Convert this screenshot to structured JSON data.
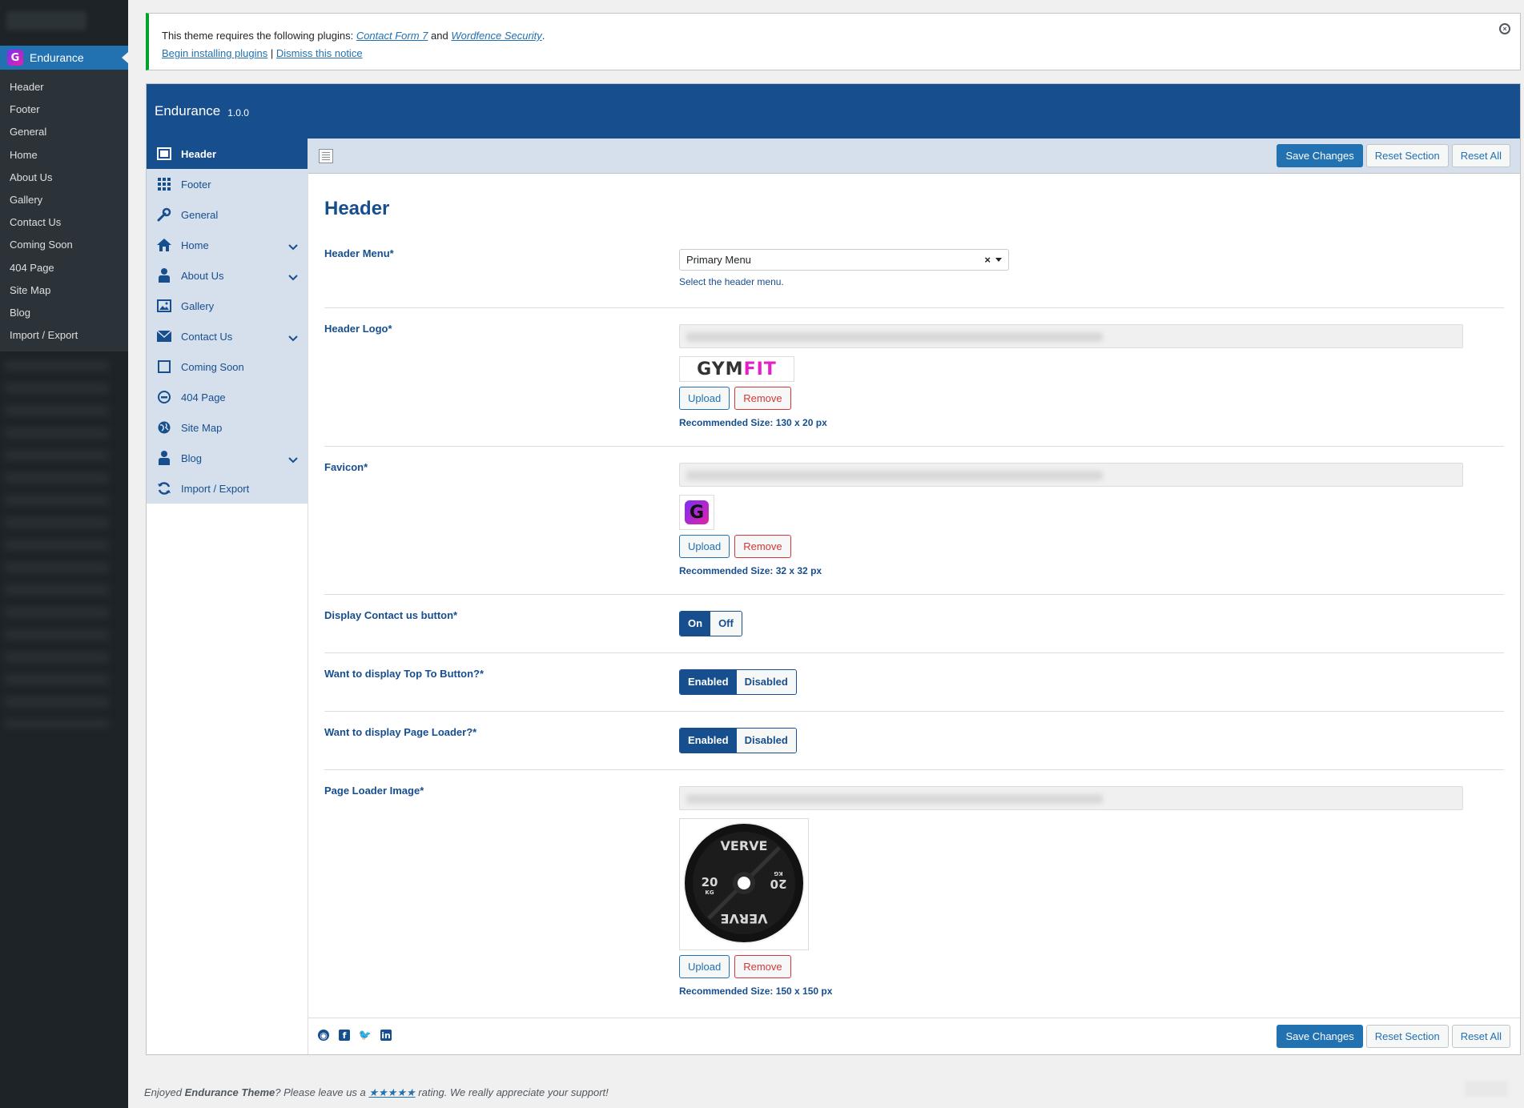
{
  "wp_menu": {
    "active": "Endurance",
    "items": [
      "Header",
      "Footer",
      "General",
      "Home",
      "About Us",
      "Gallery",
      "Contact Us",
      "Coming Soon",
      "404 Page",
      "Site Map",
      "Blog",
      "Import / Export"
    ]
  },
  "notice": {
    "text_prefix": "This theme requires the following plugins:",
    "plugin_1": "Contact Form 7",
    "and": "and",
    "plugin_2": "Wordfence Security",
    "dot": ".",
    "begin_link": "Begin installing plugins",
    "sep": "|",
    "dismiss_link": "Dismiss this notice"
  },
  "panel": {
    "title": "Endurance",
    "version": "1.0.0"
  },
  "nav": [
    {
      "label": "Header",
      "icon": "window-icon",
      "active": true
    },
    {
      "label": "Footer",
      "icon": "grid-icon"
    },
    {
      "label": "General",
      "icon": "wrench-icon"
    },
    {
      "label": "Home",
      "icon": "home-icon",
      "chevron": true
    },
    {
      "label": "About Us",
      "icon": "user-icon",
      "chevron": true
    },
    {
      "label": "Gallery",
      "icon": "image-icon"
    },
    {
      "label": "Contact Us",
      "icon": "envelope-icon",
      "chevron": true
    },
    {
      "label": "Coming Soon",
      "icon": "square-icon"
    },
    {
      "label": "404 Page",
      "icon": "minus-circle-icon"
    },
    {
      "label": "Site Map",
      "icon": "globe-icon"
    },
    {
      "label": "Blog",
      "icon": "user-icon",
      "chevron": true
    },
    {
      "label": "Import / Export",
      "icon": "refresh-icon"
    }
  ],
  "toolbar": {
    "save": "Save Changes",
    "reset_section": "Reset Section",
    "reset_all": "Reset All"
  },
  "section": {
    "title": "Header",
    "header_menu": {
      "label": "Header Menu*",
      "value": "Primary Menu",
      "clear": "×",
      "desc": "Select the header menu."
    },
    "header_logo": {
      "label": "Header Logo*",
      "logo_text_dark": "GYM",
      "logo_text_pink": "FIT",
      "upload": "Upload",
      "remove": "Remove",
      "rec": "Recommended Size: 130 x 20 px"
    },
    "favicon": {
      "label": "Favicon*",
      "glyph": "G",
      "upload": "Upload",
      "remove": "Remove",
      "rec": "Recommended Size: 32 x 32 px"
    },
    "contact_button": {
      "label": "Display Contact us button*",
      "on": "On",
      "off": "Off"
    },
    "top_button": {
      "label": "Want to display Top To Button?*",
      "on": "Enabled",
      "off": "Disabled"
    },
    "page_loader": {
      "label": "Want to display Page Loader?*",
      "on": "Enabled",
      "off": "Disabled"
    },
    "loader_image": {
      "label": "Page Loader Image*",
      "plate_top": "VERVE",
      "plate_bottom": "VERVE",
      "plate_left": "20",
      "plate_left_unit": "KG",
      "plate_right": "20",
      "plate_right_unit": "KG",
      "upload": "Upload",
      "remove": "Remove",
      "rec": "Recommended Size: 150 x 150 px"
    }
  },
  "footer": {
    "enjoyed": "Enjoyed ",
    "theme": "Endurance Theme",
    "please": "? Please leave us a ",
    "stars": "★★★★★",
    "rest": " rating. We really appreciate your support!"
  },
  "colors": {
    "brand": "#174e8e",
    "wp_blue": "#2271b1",
    "sidebar": "#1d2327",
    "notice_green": "#00a32a"
  }
}
